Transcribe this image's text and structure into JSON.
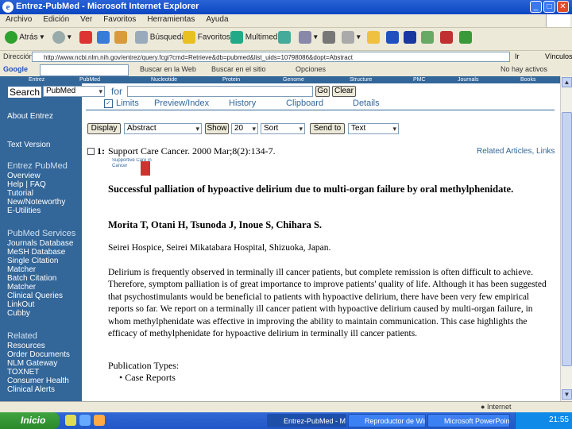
{
  "window": {
    "title": "Entrez-PubMed - Microsoft Internet Explorer",
    "controls": {
      "minimize": "_",
      "maximize": "□",
      "close": "✕"
    }
  },
  "menu": [
    "Archivo",
    "Edición",
    "Ver",
    "Favoritos",
    "Herramientas",
    "Ayuda"
  ],
  "toolbar": {
    "back": "Atrás",
    "search": "Búsqueda",
    "favorites": "Favoritos",
    "multimedia": "Multimedia"
  },
  "address": {
    "label": "Dirección",
    "url": "http://www.ncbi.nlm.nih.gov/entrez/query.fcgi?cmd=Retrieve&db=pubmed&list_uids=10798086&dopt=Abstract",
    "go": "Ir",
    "links": "Vínculos"
  },
  "googlebar": {
    "brand": "Google",
    "search_web": "Buscar en la Web",
    "search_site": "Buscar en el sitio",
    "options": "Opciones",
    "no_active": "No hay activos"
  },
  "ncbinav": [
    "Entrez",
    "PubMed",
    "Nucleotide",
    "Protein",
    "Genome",
    "Structure",
    "PMC",
    "Journals",
    "Books"
  ],
  "sidebar": {
    "search_label": "Search",
    "about": "About Entrez",
    "text_version": "Text Version",
    "pubmed_head": "Entrez PubMed",
    "pubmed_links": [
      "Overview",
      "Help | FAQ",
      "Tutorial",
      "New/Noteworthy",
      "E-Utilities"
    ],
    "services_head": "PubMed Services",
    "services_links": [
      "Journals Database",
      "MeSH Database",
      "Single Citation",
      "Matcher",
      "Batch Citation",
      "Matcher",
      "Clinical Queries",
      "LinkOut",
      "Cubby"
    ],
    "related_head": "Related",
    "related_links": [
      "Resources",
      "Order Documents",
      "NLM Gateway",
      "TOXNET",
      "Consumer Health",
      "Clinical Alerts"
    ]
  },
  "search": {
    "db": "PubMed",
    "for": "for",
    "go": "Go",
    "clear": "Clear"
  },
  "tabs": [
    "Limits",
    "Preview/Index",
    "History",
    "Clipboard",
    "Details"
  ],
  "display": {
    "display_btn": "Display",
    "format": "Abstract",
    "show_btn": "Show",
    "show_count": "20",
    "sort": "Sort",
    "send_btn": "Send to",
    "send_target": "Text"
  },
  "article": {
    "index": "1:",
    "citation": "Support Care Cancer. 2000 Mar;8(2):134-7.",
    "related": "Related Articles, Links",
    "journal_logo": "Supportive Care in Cancer",
    "title": "Successful palliation of hypoactive delirium due to multi-organ failure by oral methylphenidate.",
    "authors": "Morita T, Otani H, Tsunoda J, Inoue S, Chihara S.",
    "affiliation": "Seirei Hospice, Seirei Mikatabara Hospital, Shizuoka, Japan.",
    "abstract": "Delirium is frequently observed in terminally ill cancer patients, but complete remission is often difficult to achieve. Therefore, symptom palliation is of great importance to improve patients' quality of life. Although it has been suggested that psychostimulants would be beneficial to patients with hypoactive delirium, there have been very few empirical reports so far. We report on a terminally ill cancer patient with hypoactive delirium caused by multi-organ failure, in whom methylphenidate was effective in improving the ability to maintain communication. This case highlights the efficacy of methylphenidate for hypoactive delirium in terminally ill cancer patients.",
    "pubtypes_label": "Publication Types:",
    "pubtypes": [
      "Case Reports"
    ]
  },
  "status": {
    "zone": "Internet"
  },
  "taskbar": {
    "start": "Inicio",
    "tasks": [
      "Entrez-PubMed - Mi...",
      "Reproductor de Win...",
      "Microsoft PowerPoin..."
    ],
    "clock": "21:55"
  }
}
